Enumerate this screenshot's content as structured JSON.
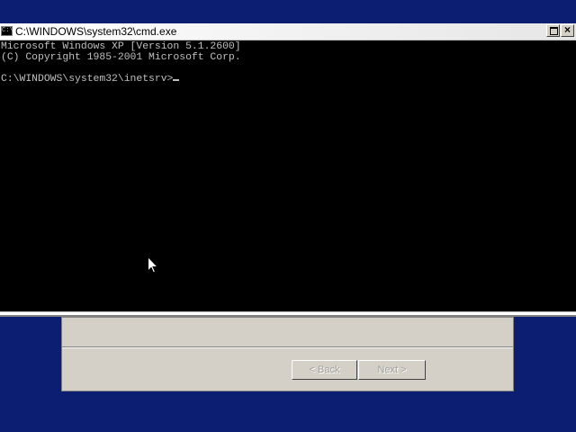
{
  "window": {
    "title": "C:\\WINDOWS\\system32\\cmd.exe",
    "icon": "cmd-icon",
    "icon_text": "C:\\"
  },
  "console": {
    "lines": [
      "Microsoft Windows XP [Version 5.1.2600]",
      "(C) Copyright 1985-2001 Microsoft Corp.",
      "C:\\WINDOWS\\system32\\inetsrv>"
    ]
  },
  "wizard": {
    "back_label": "< Back",
    "next_label": "Next >"
  },
  "colors": {
    "desktop": "#0b1e72",
    "console_bg": "#000000",
    "console_text": "#c0c0c0",
    "dialog_face": "#d4d0c8"
  }
}
